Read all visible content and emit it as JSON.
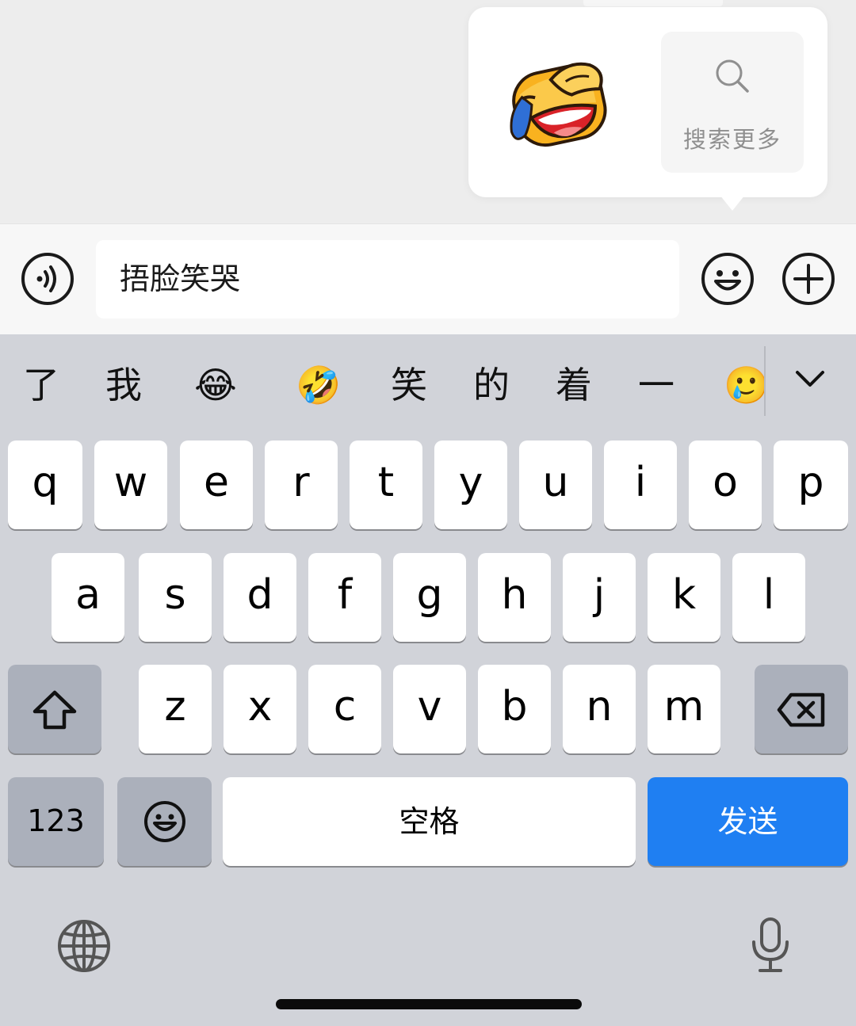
{
  "popup": {
    "sticker_icon": "face-palm-crying-sticker",
    "search_more_label": "搜索更多"
  },
  "input_bar": {
    "text_value": "捂脸笑哭",
    "voice_icon": "voice-icon",
    "emoji_icon": "emoji-icon",
    "plus_icon": "plus-icon"
  },
  "candidates": [
    "了",
    "我",
    "😂",
    "🤣",
    "笑",
    "的",
    "着",
    "一",
    "🥲"
  ],
  "keyboard": {
    "row1": [
      "q",
      "w",
      "e",
      "r",
      "t",
      "y",
      "u",
      "i",
      "o",
      "p"
    ],
    "row2": [
      "a",
      "s",
      "d",
      "f",
      "g",
      "h",
      "j",
      "k",
      "l"
    ],
    "row3": [
      "z",
      "x",
      "c",
      "v",
      "b",
      "n",
      "m"
    ],
    "numbers_label": "123",
    "space_label": "空格",
    "send_label": "发送"
  },
  "colors": {
    "send": "#1f7ff2",
    "keyboard_bg": "#d1d3d9",
    "dark_key": "#abb0bb"
  }
}
